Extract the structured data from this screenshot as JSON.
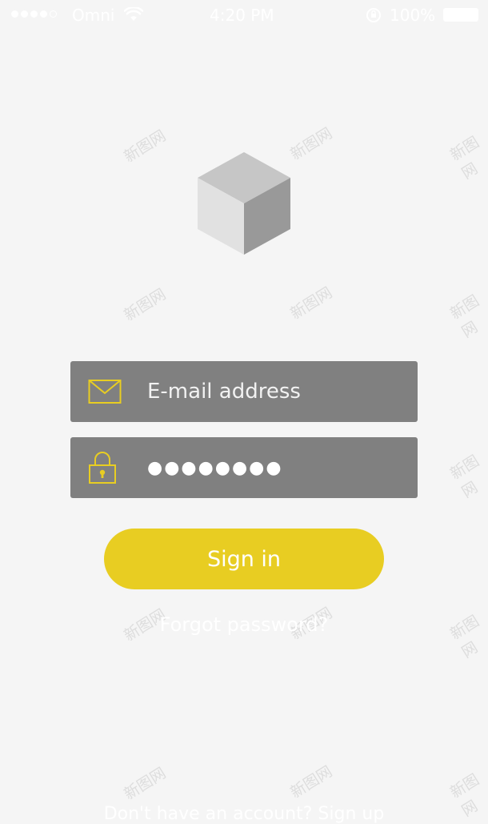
{
  "status_bar": {
    "carrier": "Omni",
    "time": "4:20 PM",
    "battery": "100%",
    "signal_icon": "signal-dots-icon",
    "wifi_icon": "wifi-icon",
    "rotation_icon": "rotation-lock-icon",
    "battery_icon": "battery-icon"
  },
  "logo": {
    "icon": "cube-icon"
  },
  "login": {
    "email_icon": "envelope-icon",
    "email_placeholder": "E-mail address",
    "password_icon": "padlock-icon",
    "password_value": "●●●●●●●●",
    "signin_label": "Sign in",
    "forgot_label": "Forgot password?",
    "bottom_label": "Don't have an account? Sign up"
  },
  "watermark": {
    "text": "新图网"
  },
  "colors": {
    "background": "#f5f5f5",
    "field_background": "#808080",
    "accent": "#e8cd22",
    "text": "#ffffff"
  }
}
